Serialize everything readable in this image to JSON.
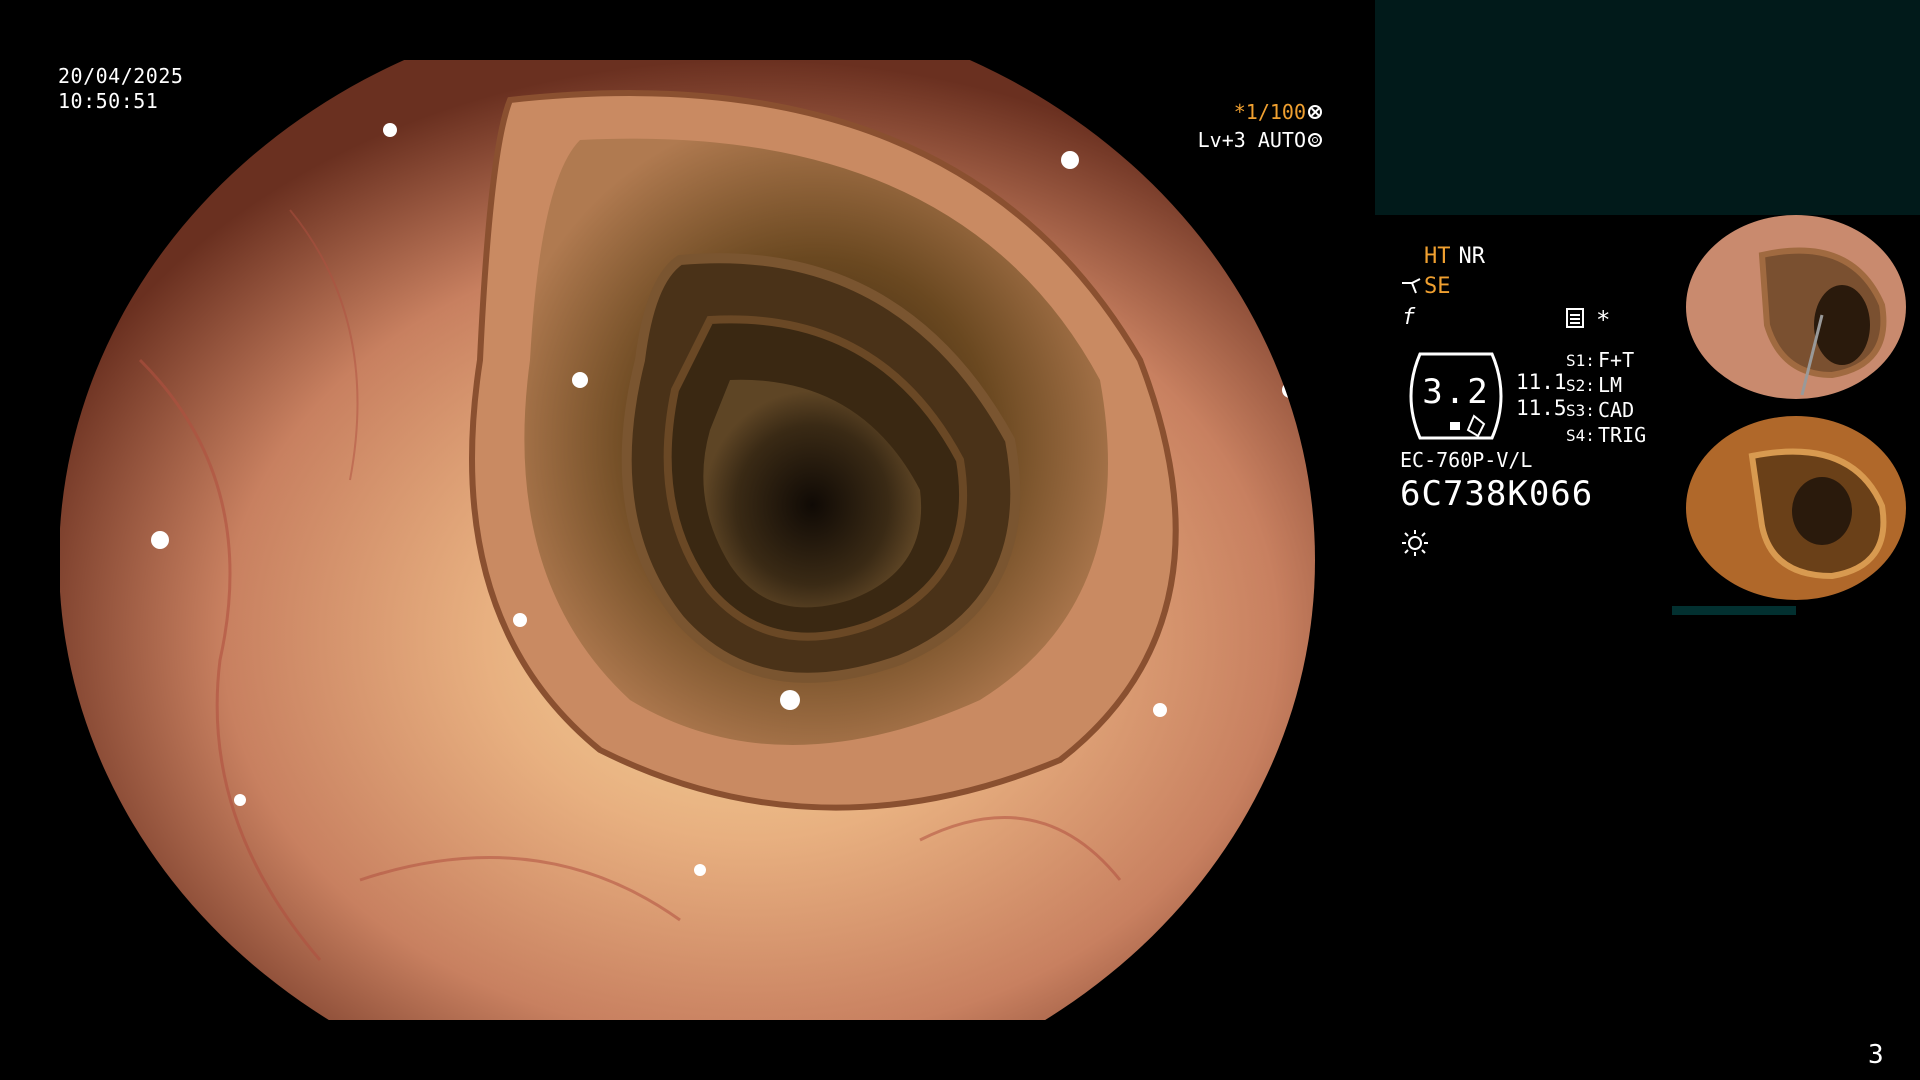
{
  "overlay": {
    "date": "20/04/2025",
    "time": "10:50:51",
    "shutter": "*1/100",
    "level": "Lv+3 AUTO"
  },
  "panel": {
    "mode_ht": "HT",
    "mode_nr": "NR",
    "se_label": "SE",
    "f_label": "f",
    "asterisk": "*",
    "hex_value": "3.2",
    "num1": "11.1",
    "num2": "11.5",
    "switches": [
      {
        "key": "S1:",
        "value": "F+T"
      },
      {
        "key": "S2:",
        "value": "LM"
      },
      {
        "key": "S3:",
        "value": "CAD"
      },
      {
        "key": "S4:",
        "value": "TRIG"
      }
    ],
    "scope_model": "EC-760P-V/L",
    "serial": "6C738K066"
  },
  "page_number": "3",
  "colors": {
    "accent_orange": "#f0a030",
    "teal_panel": "#011a1a",
    "mucosa": "#d89070"
  },
  "icons": [
    "shutter-icon",
    "auto-icon",
    "scissors-icon",
    "note-icon",
    "hexagon-badge",
    "sun-icon"
  ]
}
